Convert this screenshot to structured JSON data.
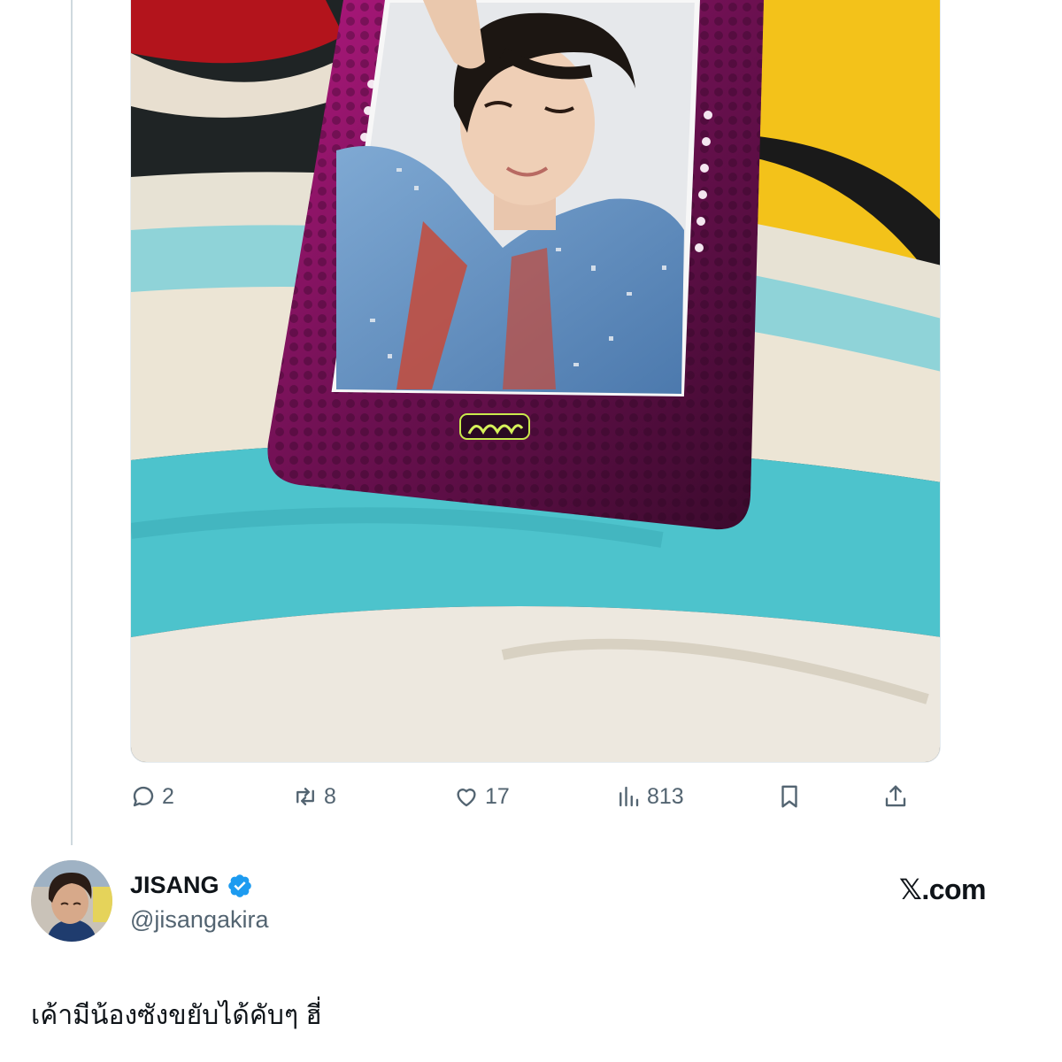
{
  "quoted_tweet": {
    "media_alt": "photo card in pink holder",
    "actions": {
      "reply": {
        "icon": "reply-icon",
        "count": "2"
      },
      "retweet": {
        "icon": "retweet-icon",
        "count": "8"
      },
      "like": {
        "icon": "heart-icon",
        "count": "17"
      },
      "views": {
        "icon": "views-icon",
        "count": "813"
      },
      "bookmark": {
        "icon": "bookmark-icon"
      },
      "share": {
        "icon": "share-icon"
      }
    }
  },
  "author": {
    "display_name": "JISANG",
    "handle": "@jisangakira",
    "verified": true
  },
  "brand": "𝕏.com",
  "tweet_text": "เค้ามีน้องซังขยับได้คับๆ ฮี่",
  "colors": {
    "text_primary": "#0f1419",
    "text_secondary": "#536471",
    "verified_blue": "#1d9bf0",
    "border": "#cfd9de"
  }
}
